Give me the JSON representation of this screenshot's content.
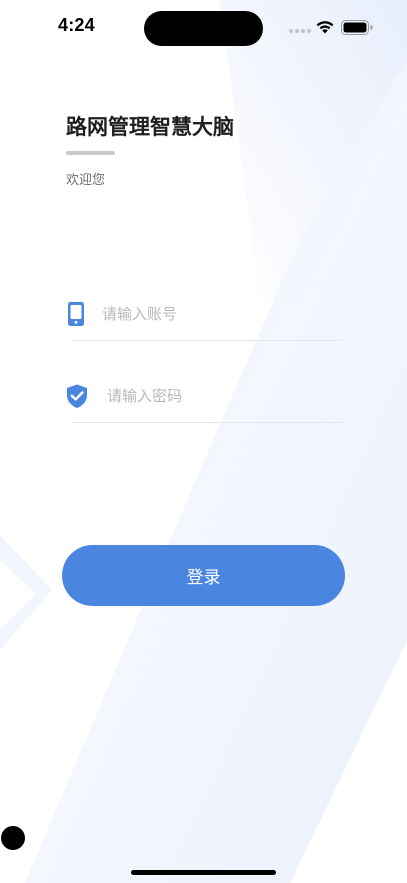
{
  "status_bar": {
    "time": "4:24"
  },
  "header": {
    "title": "路网管理智慧大脑",
    "subtitle": "欢迎您"
  },
  "form": {
    "account": {
      "placeholder": "请输入账号",
      "value": "",
      "icon": "phone-icon"
    },
    "password": {
      "placeholder": "请输入密码",
      "value": "",
      "icon": "shield-check-icon"
    },
    "login_label": "登录"
  },
  "colors": {
    "accent": "#4a86e0",
    "background_shape": "#e6eefb",
    "placeholder": "#b6b8bd",
    "divider": "#e4e6ea"
  }
}
